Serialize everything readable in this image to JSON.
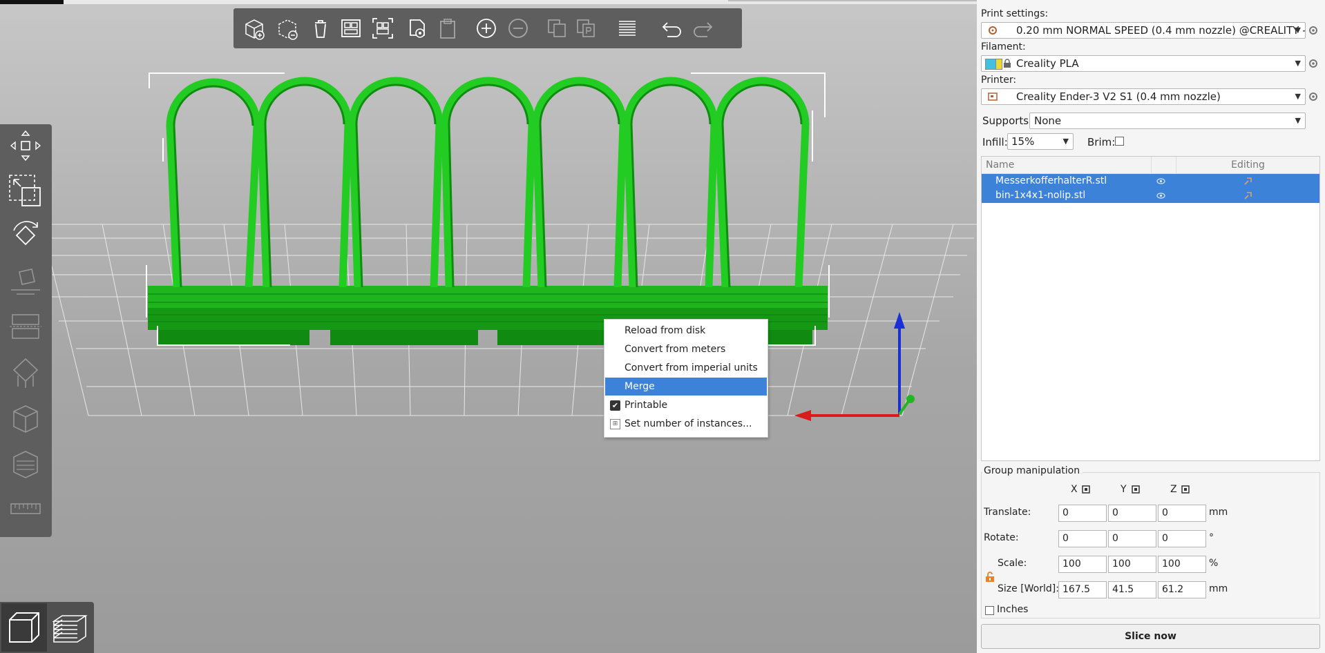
{
  "context_menu": {
    "items": [
      {
        "label": "Reload from disk"
      },
      {
        "label": "Convert from meters"
      },
      {
        "label": "Convert from imperial units"
      },
      {
        "label": "Merge"
      },
      {
        "label": "Printable"
      },
      {
        "label": "Set number of instances..."
      }
    ],
    "selected_item": "Merge",
    "printable_checked": true,
    "selection_color": "#3c82d8"
  },
  "toolbar": {
    "icons": [
      "add-icon",
      "delete-icon",
      "delete-all-icon",
      "arrange-icon",
      "arrange-selection-icon",
      "split-icon",
      "paste-icon",
      "add-instance-icon",
      "remove-instance-icon",
      "split-objects-icon",
      "split-parts-icon",
      "layers-editing-icon",
      "undo-icon",
      "redo-icon"
    ]
  },
  "left_tools": {
    "icons": [
      "move-icon",
      "scale-icon",
      "rotate-icon",
      "place-on-face-icon",
      "cut-icon",
      "supports-paint-icon",
      "seam-paint-icon",
      "mmu-paint-icon",
      "measure-icon"
    ]
  },
  "view_buttons": {
    "icons": [
      "3d-view-icon",
      "preview-icon"
    ]
  },
  "right_panel": {
    "print_settings": {
      "label": "Print settings:",
      "value": "0.20 mm NORMAL SPEED (0.4 mm nozzle) @CREALITY - ..."
    },
    "filament": {
      "label": "Filament:",
      "value": "Creality PLA",
      "color": "#3fc1e0"
    },
    "printer": {
      "label": "Printer:",
      "value": "Creality Ender-3 V2 S1 (0.4 mm nozzle)"
    },
    "supports": {
      "label": "Supports:",
      "value": "None"
    },
    "infill": {
      "label": "Infill:",
      "value": "15%"
    },
    "brim": {
      "label": "Brim:",
      "checked": false
    },
    "object_list": {
      "columns": [
        "Name",
        "",
        "Editing"
      ],
      "rows": [
        {
          "name": "MesserkofferhalterR.stl"
        },
        {
          "name": "bin-1x4x1-nolip.stl"
        }
      ]
    },
    "group_manipulation": {
      "title": "Group manipulation",
      "axis_x": "X",
      "axis_y": "Y",
      "axis_z": "Z",
      "translate": {
        "label": "Translate:",
        "x": "0",
        "y": "0",
        "z": "0",
        "unit": "mm"
      },
      "rotate": {
        "label": "Rotate:",
        "x": "0",
        "y": "0",
        "z": "0",
        "unit": "°"
      },
      "scale": {
        "label": "Scale:",
        "x": "100",
        "y": "100",
        "z": "100",
        "unit": "%"
      },
      "size": {
        "label": "Size [World]:",
        "x": "167.5",
        "y": "41.5",
        "z": "61.2",
        "unit": "mm"
      },
      "inches": {
        "label": "Inches",
        "checked": false
      }
    },
    "slice_button": "Slice now"
  },
  "colors": {
    "model_green": "#22cc22",
    "toolbar_gray": "#5e5e5e",
    "axis_x": "#d81c1c",
    "axis_y": "#22b622",
    "axis_z": "#1a2fd4"
  }
}
